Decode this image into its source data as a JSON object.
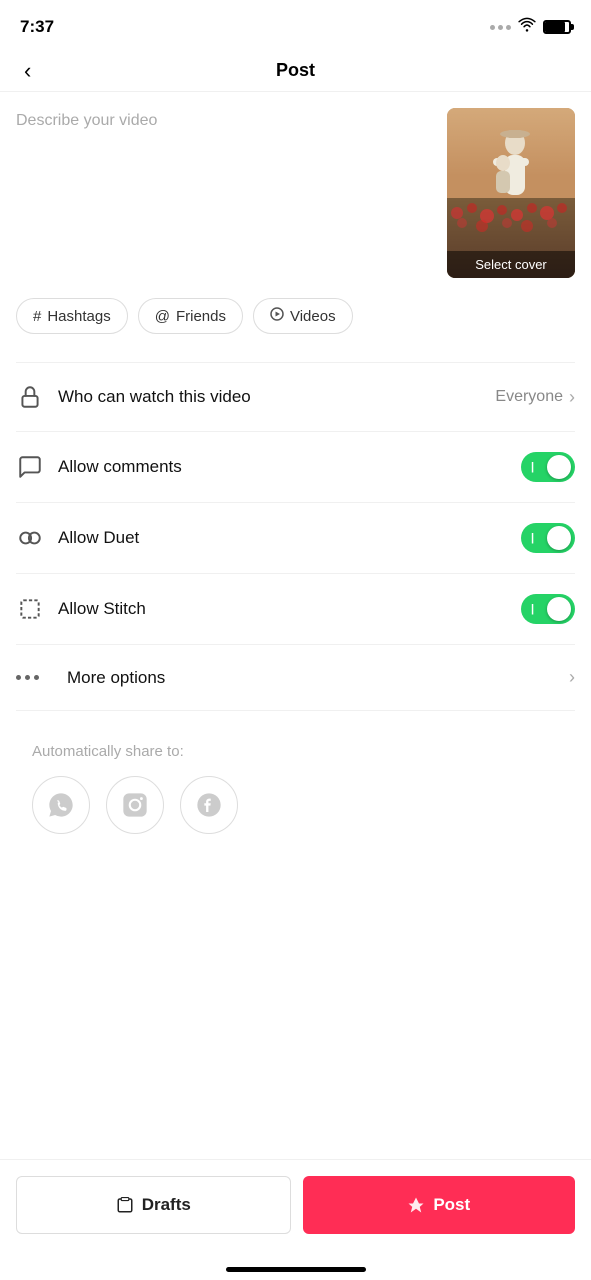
{
  "statusBar": {
    "time": "7:37"
  },
  "header": {
    "backLabel": "‹",
    "title": "Post"
  },
  "videoSection": {
    "descriptionPlaceholder": "Describe your video",
    "selectCoverLabel": "Select cover"
  },
  "tagButtons": [
    {
      "icon": "#",
      "label": "Hashtags"
    },
    {
      "icon": "@",
      "label": "Friends"
    },
    {
      "icon": "▷",
      "label": "Videos"
    }
  ],
  "settings": {
    "whoCanWatch": {
      "label": "Who can watch this video",
      "value": "Everyone"
    },
    "allowComments": {
      "label": "Allow comments",
      "enabled": true
    },
    "allowDuet": {
      "label": "Allow Duet",
      "enabled": true
    },
    "allowStitch": {
      "label": "Allow Stitch",
      "enabled": true
    },
    "moreOptions": {
      "label": "More options"
    }
  },
  "bottomSection": {
    "autoShareLabel": "Automatically share to:",
    "socialIcons": [
      "whatsapp",
      "instagram",
      "facebook"
    ]
  },
  "actionBar": {
    "draftsLabel": "Drafts",
    "postLabel": "Post"
  }
}
